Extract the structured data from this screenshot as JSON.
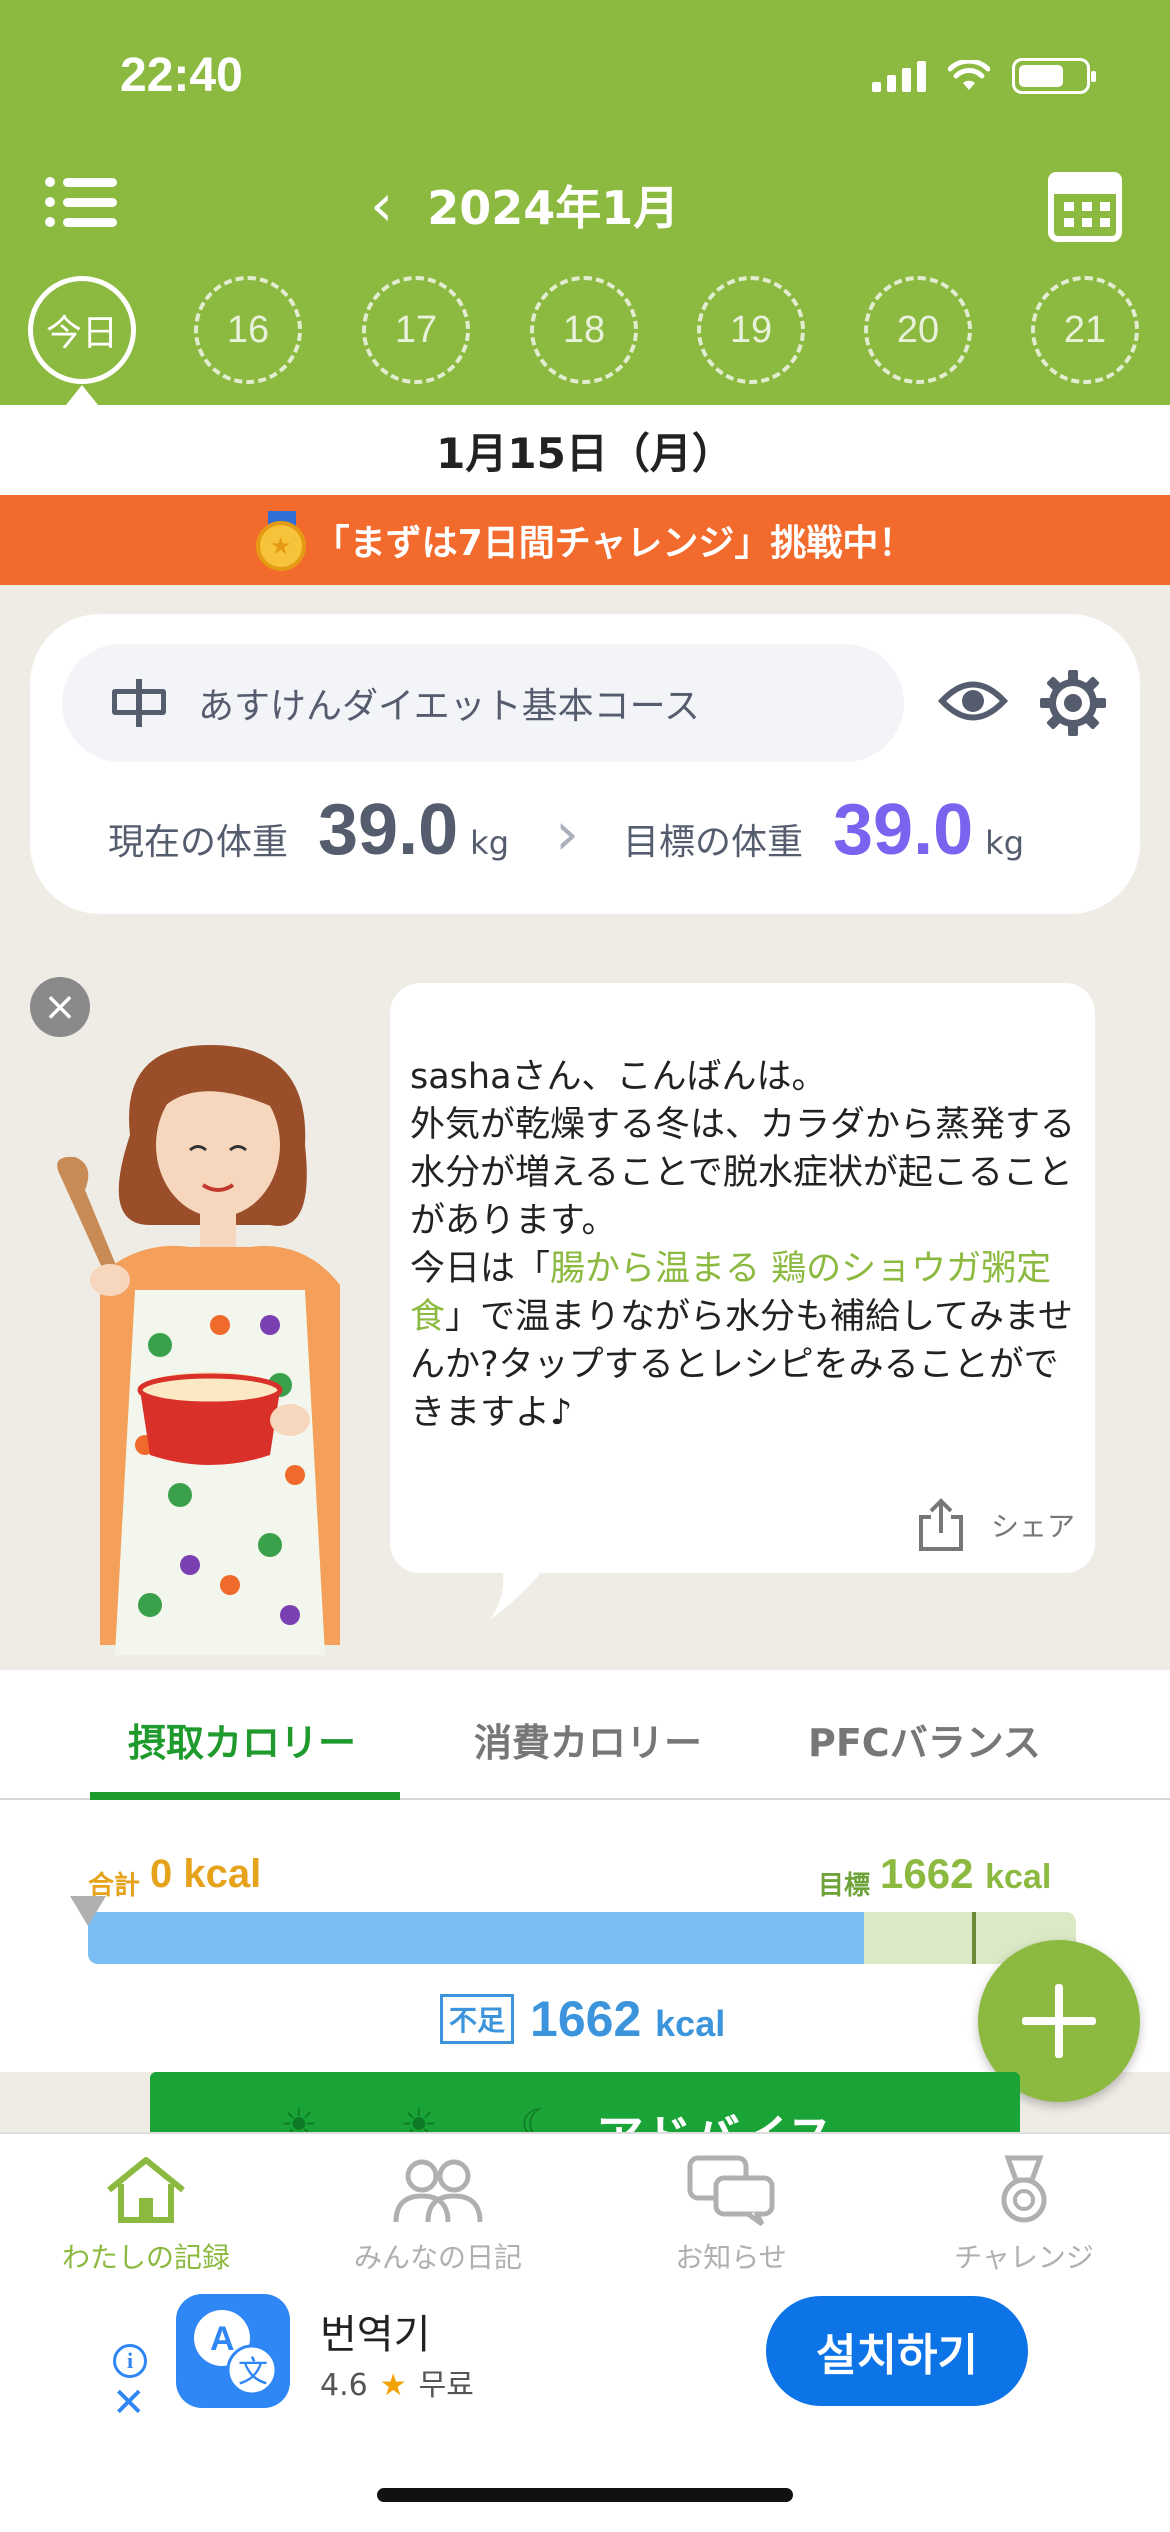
{
  "status": {
    "time": "22:40"
  },
  "header": {
    "month": "2024年1月",
    "days": [
      "今日",
      "16",
      "17",
      "18",
      "19",
      "20",
      "21"
    ]
  },
  "date_label": "1月15日（月）",
  "challenge": "「まずは7日間チャレンジ」挑戦中！",
  "course": {
    "name": "あすけんダイエット基本コース",
    "current_label": "現在の体重",
    "current_value": "39.0",
    "goal_label": "目標の体重",
    "goal_value": "39.0",
    "unit": "kg"
  },
  "advice": {
    "text_before": "sashaさん、こんばんは。\n外気が乾燥する冬は、カラダから蒸発する水分が増えることで脱水症状が起こることがあります。\n今日は「",
    "recipe": "腸から温まる 鶏のショウガ粥定食",
    "text_after": "」で温まりながら水分も補給してみませんか?タップするとレシピをみることができますよ♪",
    "share_label": "シェア"
  },
  "tabs": [
    "摂取カロリー",
    "消費カロリー",
    "PFCバランス"
  ],
  "calories": {
    "total_label": "合計",
    "total_value": "0",
    "goal_label": "目標",
    "goal_value": "1662",
    "unit": "kcal",
    "short_label": "不足",
    "short_value": "1662",
    "progress_fraction": 0.785,
    "goal_marker_fraction": 0.895
  },
  "advice_button": "アドバイス",
  "nav": [
    "わたしの記録",
    "みんなの日記",
    "お知らせ",
    "チャレンジ"
  ],
  "ad": {
    "app_name": "번역기",
    "rating": "4.6",
    "price": "무료",
    "install": "설치하기"
  },
  "colors": {
    "brand_green": "#8cb940",
    "orange": "#f26a2c",
    "blue": "#79bff5",
    "goal_purple": "#7b62ef"
  }
}
